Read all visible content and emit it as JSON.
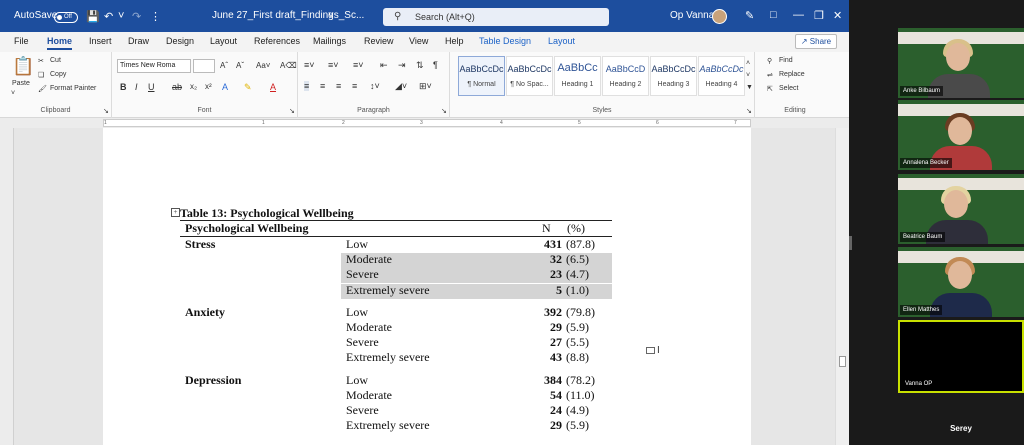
{
  "titlebar": {
    "autosave_label": "AutoSave",
    "autosave_state": "Off",
    "doc_title": "June 27_First draft_Findings_Sc...",
    "search_placeholder": "Search (Alt+Q)",
    "user_name": "Op Vanna"
  },
  "menu": {
    "tabs": [
      "File",
      "Home",
      "Insert",
      "Draw",
      "Design",
      "Layout",
      "References",
      "Mailings",
      "Review",
      "View",
      "Help",
      "Table Design",
      "Layout"
    ],
    "active_tab": "Home",
    "share_label": "Share"
  },
  "ribbon": {
    "clipboard": {
      "paste": "Paste",
      "cut": "Cut",
      "copy": "Copy",
      "format_painter": "Format Painter",
      "label": "Clipboard"
    },
    "font": {
      "font_name": "Times New Roma",
      "label": "Font"
    },
    "paragraph": {
      "label": "Paragraph"
    },
    "styles": {
      "items": [
        {
          "preview": "AaBbCcDc",
          "name": "¶ Normal"
        },
        {
          "preview": "AaBbCcDc",
          "name": "¶ No Spac..."
        },
        {
          "preview": "AaBbCc",
          "name": "Heading 1"
        },
        {
          "preview": "AaBbCcD",
          "name": "Heading 2"
        },
        {
          "preview": "AaBbCcDc",
          "name": "Heading 3"
        },
        {
          "preview": "AaBbCcDc",
          "name": "Heading 4"
        }
      ],
      "label": "Styles"
    },
    "editing": {
      "find": "Find",
      "replace": "Replace",
      "select": "Select",
      "label": "Editing"
    }
  },
  "ruler": {
    "numbers": [
      "1",
      "1",
      "2",
      "3",
      "4",
      "5",
      "6",
      "7"
    ]
  },
  "document": {
    "table_title": "Table 13: Psychological Wellbeing",
    "header": {
      "category": "Psychological Wellbeing",
      "n": "N",
      "pct": "(%)"
    },
    "groups": [
      {
        "name": "Stress",
        "rows": [
          {
            "level": "Low",
            "n": "431",
            "pct": "(87.8)"
          },
          {
            "level": "Moderate",
            "n": "32",
            "pct": "(6.5)"
          },
          {
            "level": "Severe",
            "n": "23",
            "pct": "(4.7)"
          },
          {
            "level": "Extremely severe",
            "n": "5",
            "pct": "(1.0)"
          }
        ]
      },
      {
        "name": "Anxiety",
        "rows": [
          {
            "level": "Low",
            "n": "392",
            "pct": "(79.8)"
          },
          {
            "level": "Moderate",
            "n": "29",
            "pct": "(5.9)"
          },
          {
            "level": "Severe",
            "n": "27",
            "pct": "(5.5)"
          },
          {
            "level": "Extremely severe",
            "n": "43",
            "pct": "(8.8)"
          }
        ]
      },
      {
        "name": "Depression",
        "rows": [
          {
            "level": "Low",
            "n": "384",
            "pct": "(78.2)"
          },
          {
            "level": "Moderate",
            "n": "54",
            "pct": "(11.0)"
          },
          {
            "level": "Severe",
            "n": "24",
            "pct": "(4.9)"
          },
          {
            "level": "Extremely severe",
            "n": "29",
            "pct": "(5.9)"
          }
        ]
      }
    ]
  },
  "participants": [
    {
      "name": "Anke Bilbaum"
    },
    {
      "name": "Annalena Becker"
    },
    {
      "name": "Beatrice Baum"
    },
    {
      "name": "Ellen Matthes"
    },
    {
      "name": "Vanna OP"
    }
  ],
  "self_name": "Serey",
  "colors": {
    "word_blue": "#1d4e9e",
    "active_speaker": "#c8e000",
    "table_shade": "#d4d4d4"
  }
}
